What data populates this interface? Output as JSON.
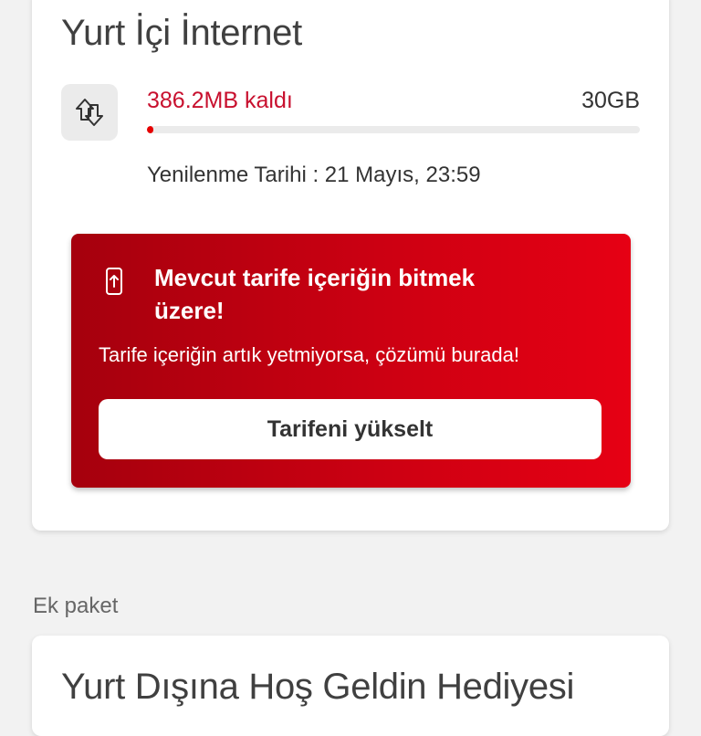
{
  "domestic_internet": {
    "title": "Yurt İçi İnternet",
    "icon": "data-transfer-icon",
    "remaining_label": "386.2MB kaldı",
    "total_label": "30GB",
    "remaining_fraction": 0.0126,
    "renewal_label": "Yenilenme Tarihi : 21 Mayıs, 23:59"
  },
  "alert": {
    "icon": "phone-upgrade-icon",
    "title": "Mevcut tarife içeriğin bitmek üzere!",
    "description": "Tarife içeriğin artık yetmiyorsa, çözümü burada!",
    "button_label": "Tarifeni yükselt"
  },
  "extra_packages": {
    "section_label": "Ek paket",
    "card_title": "Yurt Dışına Hoş Geldin Hediyesi"
  },
  "colors": {
    "accent": "#e60000",
    "background": "#f2f2f2",
    "card": "#ffffff"
  }
}
